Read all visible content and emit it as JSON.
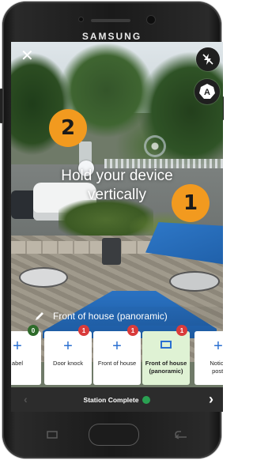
{
  "device": {
    "brand": "SAMSUNG"
  },
  "camera": {
    "hint_lines": [
      "Hold your device",
      "vertically"
    ],
    "close_icon": "close-icon",
    "flash_icon": "flash-off-icon",
    "auto_icon": "auto-mode-icon",
    "callouts": [
      "1",
      "2"
    ]
  },
  "section": {
    "title": "Front of house (panoramic)",
    "icon": "pencil-icon"
  },
  "cards": [
    {
      "label": "abel",
      "badge": "0",
      "badge_color": "#2e6b2a",
      "icon": "plus-icon"
    },
    {
      "label": "Door knock",
      "badge": "1",
      "badge_color": "#d93b3b",
      "icon": "plus-icon"
    },
    {
      "label": "Front of house",
      "badge": "1",
      "badge_color": "#d93b3b",
      "icon": "plus-icon"
    },
    {
      "label_line1": "Front of house",
      "label_line2": "(panoramic)",
      "badge": "1",
      "badge_color": "#d93b3b",
      "icon": "panorama-icon",
      "active": true
    },
    {
      "label_line1": "Notice",
      "label_line2": "posti",
      "icon": "plus-icon"
    }
  ],
  "footer": {
    "status": "Station Complete",
    "prev_icon": "chevron-left-icon",
    "next_icon": "chevron-right-icon",
    "accent": "#2aa152"
  },
  "colors": {
    "callout": "#f29a1f",
    "accent_blue": "#2a6fd1",
    "active_card": "#dff2d4",
    "badge_red": "#d93b3b"
  }
}
